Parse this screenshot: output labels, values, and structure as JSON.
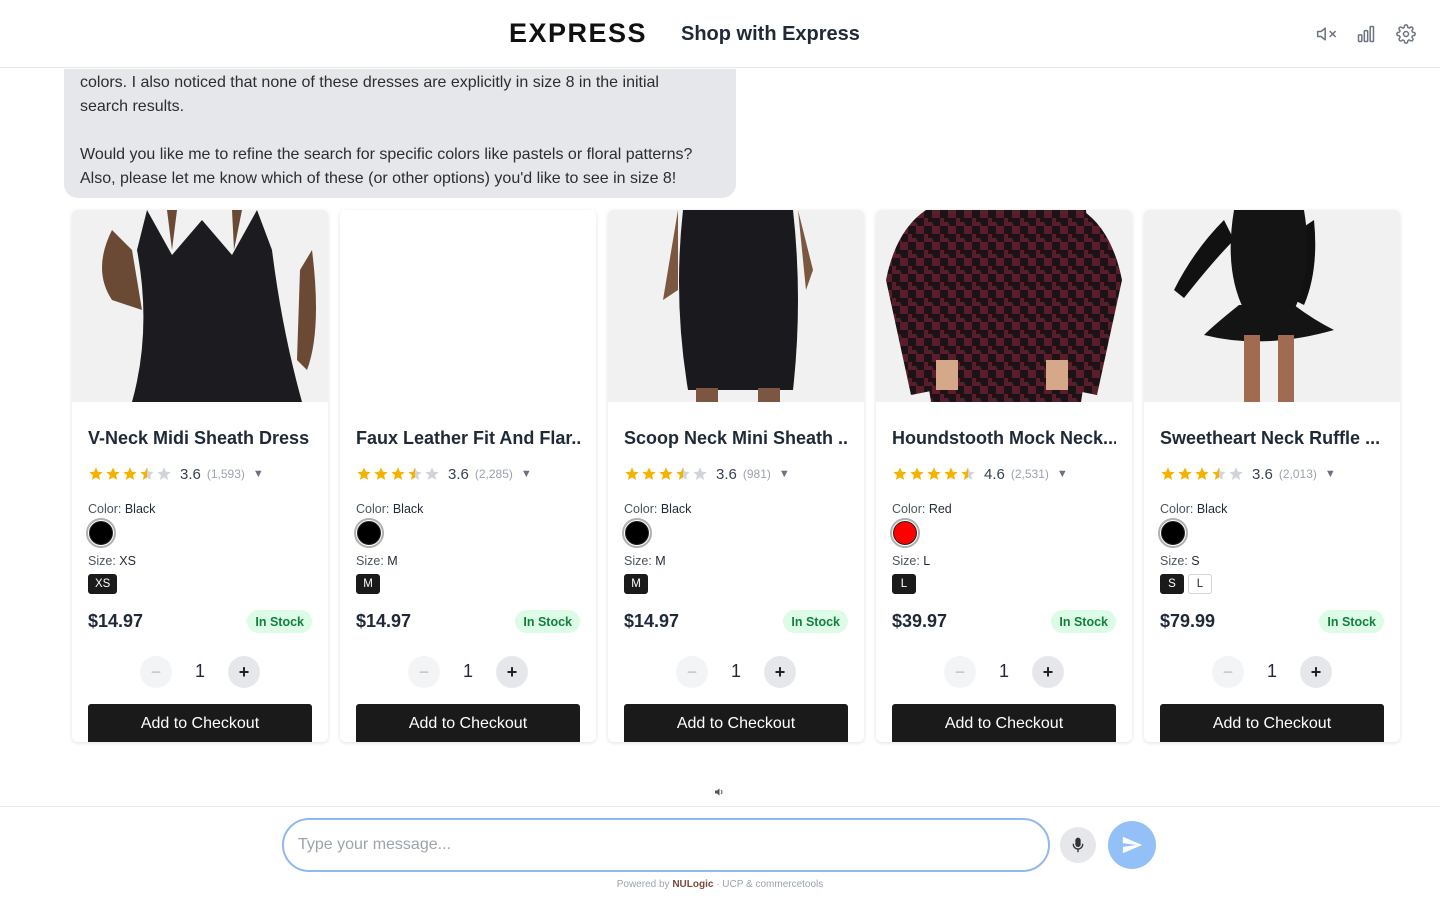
{
  "header": {
    "logo": "EXPRESS",
    "title": "Shop with Express"
  },
  "chat": {
    "line1": "colors. I also noticed that none of these dresses are explicitly in size 8 in the initial",
    "line2": "search results.",
    "line3": "Would you like me to refine the search for specific colors like pastels or floral patterns?",
    "line4": "Also, please let me know which of these (or other options) you'd like to see in size 8!"
  },
  "labels": {
    "color": "Color:",
    "size": "Size:",
    "add_to_checkout": "Add to Checkout",
    "in_stock": "In Stock",
    "minus": "−",
    "plus": "+"
  },
  "products": [
    {
      "name": "V-Neck Midi Sheath Dress",
      "rating": "3.6",
      "reviews": "(1,593)",
      "stars": 3.6,
      "color": "Black",
      "swatch": "#000000",
      "size": "XS",
      "sizes": [
        "XS"
      ],
      "price": "$14.97",
      "qty": "1",
      "image": "black-sheath-dress"
    },
    {
      "name": "Faux Leather Fit And Flar...",
      "rating": "3.6",
      "reviews": "(2,285)",
      "stars": 3.6,
      "color": "Black",
      "swatch": "#000000",
      "size": "M",
      "sizes": [
        "M"
      ],
      "price": "$14.97",
      "qty": "1",
      "image": "blank"
    },
    {
      "name": "Scoop Neck Mini Sheath ...",
      "rating": "3.6",
      "reviews": "(981)",
      "stars": 3.6,
      "color": "Black",
      "swatch": "#000000",
      "size": "M",
      "sizes": [
        "M"
      ],
      "price": "$14.97",
      "qty": "1",
      "image": "black-mini-dress"
    },
    {
      "name": "Houndstooth Mock Neck...",
      "rating": "4.6",
      "reviews": "(2,531)",
      "stars": 4.6,
      "color": "Red",
      "swatch": "#ff0000",
      "size": "L",
      "sizes": [
        "L"
      ],
      "price": "$39.97",
      "qty": "1",
      "image": "houndstooth-dress"
    },
    {
      "name": "Sweetheart Neck Ruffle ...",
      "rating": "3.6",
      "reviews": "(2,013)",
      "stars": 3.6,
      "color": "Black",
      "swatch": "#000000",
      "size": "S",
      "sizes": [
        "S",
        "L"
      ],
      "price": "$79.99",
      "qty": "1",
      "image": "ruffle-dress"
    }
  ],
  "input": {
    "placeholder": "Type your message..."
  },
  "footer": {
    "powered_prefix": "Powered by",
    "brand": "NULogic",
    "suffix": "· UCP & commercetools"
  },
  "colors": {
    "accent_blue": "#93b8f0",
    "star": "#f5b301",
    "in_stock_bg": "#dcfce7",
    "in_stock_text": "#15803d"
  }
}
